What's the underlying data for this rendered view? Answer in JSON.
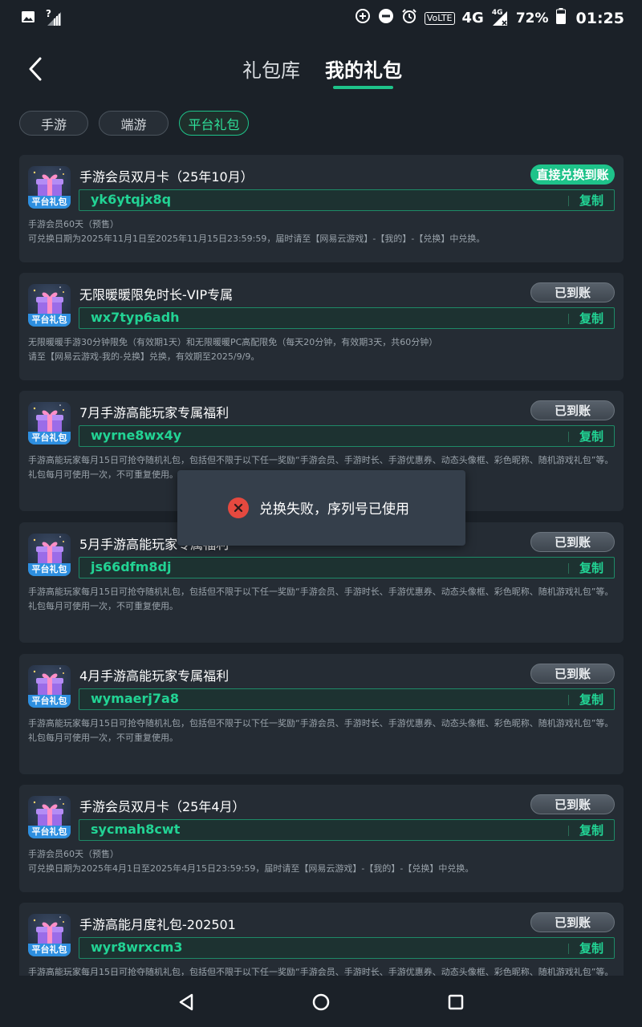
{
  "status_bar": {
    "time": "01:25",
    "battery_pct": "72%",
    "volte": "VoLTE",
    "network": "4G",
    "network_small": "4G",
    "signal_label": "?"
  },
  "header": {
    "tab_library": "礼包库",
    "tab_mine": "我的礼包"
  },
  "chips": [
    "手游",
    "端游",
    "平台礼包"
  ],
  "gift_label": "平台礼包",
  "copy_label": "复制",
  "cards": [
    {
      "title": "手游会员双月卡（25年10月）",
      "status": "直接兑换到账",
      "code": "yk6ytqjx8q",
      "desc1": "手游会员60天（预售）",
      "desc2": "可兑换日期为2025年11月1日至2025年11月15日23:59:59，届时请至【网易云游戏】-【我的】-【兑换】中兑换。"
    },
    {
      "title": "无限暖暖限免时长-VIP专属",
      "status": "已到账",
      "code": "wx7typ6adh",
      "desc1": "无限暖暖手游30分钟限免（有效期1天）和无限暖暖PC高配限免（每天20分钟，有效期3天，共60分钟）",
      "desc2": "请至【网易云游戏-我的-兑换】兑换，有效期至2025/9/9。"
    },
    {
      "title": "7月手游高能玩家专属福利",
      "status": "已到账",
      "code": "wyrne8wx4y",
      "desc1": "手游高能玩家每月15日可抢夺随机礼包，包括但不限于以下任一奖励“手游会员、手游时长、手游优惠券、动态头像框、彩色昵称、随机游戏礼包”等。",
      "desc2": "礼包每月可使用一次，不可重复使用。"
    },
    {
      "title": "5月手游高能玩家专属福利",
      "status": "已到账",
      "code": "js66dfm8dj",
      "desc1": "手游高能玩家每月15日可抢夺随机礼包，包括但不限于以下任一奖励“手游会员、手游时长、手游优惠券、动态头像框、彩色昵称、随机游戏礼包”等。",
      "desc2": "礼包每月可使用一次，不可重复使用。"
    },
    {
      "title": "4月手游高能玩家专属福利",
      "status": "已到账",
      "code": "wymaerj7a8",
      "desc1": "手游高能玩家每月15日可抢夺随机礼包，包括但不限于以下任一奖励“手游会员、手游时长、手游优惠券、动态头像框、彩色昵称、随机游戏礼包”等。",
      "desc2": "礼包每月可使用一次，不可重复使用。"
    },
    {
      "title": "手游会员双月卡（25年4月）",
      "status": "已到账",
      "code": "sycmah8cwt",
      "desc1": "手游会员60天（预售）",
      "desc2": "可兑换日期为2025年4月1日至2025年4月15日23:59:59，届时请至【网易云游戏】-【我的】-【兑换】中兑换。"
    },
    {
      "title": "手游高能月度礼包-202501",
      "status": "已到账",
      "code": "wyr8wrxcm3",
      "desc1": "手游高能玩家每月15日可抢夺随机礼包，包括但不限于以下任一奖励“手游会员、手游时长、手游优惠券、动态头像框、彩色昵称、随机游戏礼包”等。",
      "desc2": ""
    }
  ],
  "toast": {
    "message": "兑换失败，序列号已使用"
  },
  "colors": {
    "accent": "#1ec38a",
    "background": "#1b2128",
    "card": "#252c34",
    "error": "#e5493f"
  }
}
